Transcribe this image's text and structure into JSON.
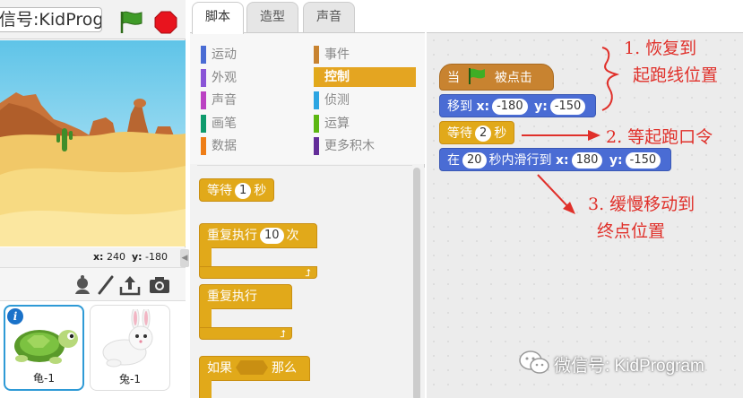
{
  "stage_header": {
    "project_title": "信号:KidProg"
  },
  "stage_info": {
    "x_label": "x:",
    "x_value": "240",
    "y_label": "y:",
    "y_value": "-180"
  },
  "sprites": [
    {
      "name": "龟-1"
    },
    {
      "name": "兔-1"
    }
  ],
  "info_badge": "i",
  "tabs": [
    {
      "label": "脚本"
    },
    {
      "label": "造型"
    },
    {
      "label": "声音"
    }
  ],
  "categories": [
    {
      "label": "运动",
      "color": "#4a6cd4"
    },
    {
      "label": "外观",
      "color": "#8a55d7"
    },
    {
      "label": "声音",
      "color": "#bb42c3"
    },
    {
      "label": "画笔",
      "color": "#0e9a6c"
    },
    {
      "label": "数据",
      "color": "#ee7d16"
    },
    {
      "label": "事件",
      "color": "#c88330"
    },
    {
      "label": "控制",
      "color": "#e1a91a"
    },
    {
      "label": "侦测",
      "color": "#2ca5e2"
    },
    {
      "label": "运算",
      "color": "#5cb712"
    },
    {
      "label": "更多积木",
      "color": "#632d99"
    }
  ],
  "palette_blocks": {
    "wait_label": "等待",
    "wait_value": "1",
    "wait_unit": "秒",
    "repeat_label": "重复执行",
    "repeat_value": "10",
    "repeat_unit": "次",
    "forever_label": "重复执行",
    "if_label": "如果",
    "if_then": "那么"
  },
  "script": {
    "hat_when": "当",
    "hat_clicked": "被点击",
    "goto_label": "移到",
    "goto_x_label": "x:",
    "goto_x": "-180",
    "goto_y_label": "y:",
    "goto_y": "-150",
    "wait_label": "等待",
    "wait_value": "2",
    "wait_unit": "秒",
    "glide_label": "在",
    "glide_secs": "20",
    "glide_mid": "秒内滑行到",
    "glide_x_label": "x:",
    "glide_x": "180",
    "glide_y_label": "y:",
    "glide_y": "-150"
  },
  "annotations": {
    "note1_line1": "1.  恢复到",
    "note1_line2": "起跑线位置",
    "note2": "2.  等起跑口令",
    "note3_line1": "3.  缓慢移动到",
    "note3_line2": "终点位置",
    "color": "#e0302a"
  },
  "watermark": "微信号: KidProgram"
}
